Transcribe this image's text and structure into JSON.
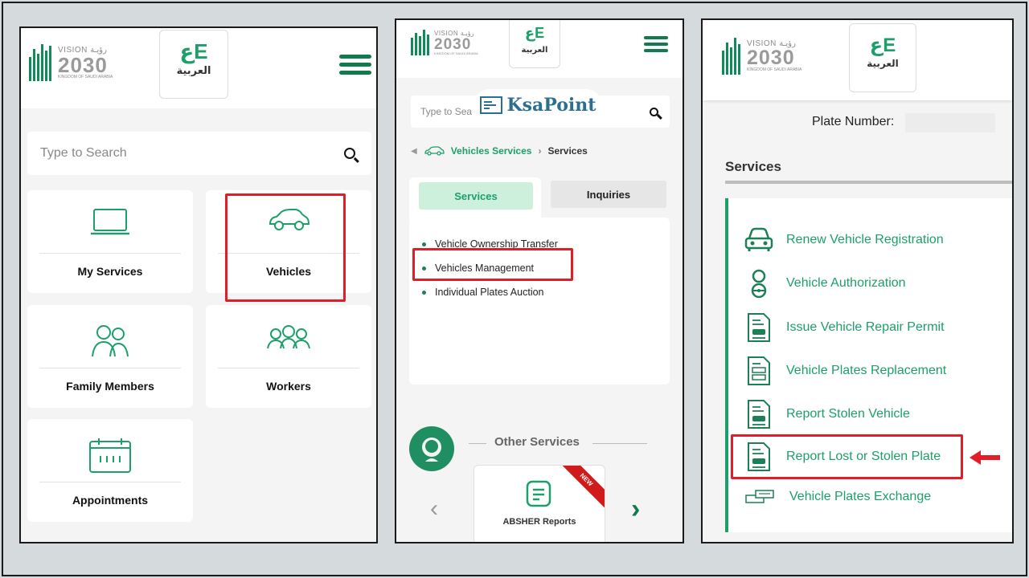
{
  "colors": {
    "brand_green": "#1d9f6a",
    "highlight_red": "#e31d25"
  },
  "header": {
    "vision_label": "VISION رؤيـة",
    "vision_year": "2030",
    "vision_sub": "KINGDOM OF SAUDI ARABIA",
    "lang_label": "العربية",
    "lang_glyph": "عE"
  },
  "panel1": {
    "search_placeholder": "Type to Search",
    "tiles": [
      {
        "label": "My Services",
        "icon": "laptop-icon"
      },
      {
        "label": "Vehicles",
        "icon": "car-icon"
      },
      {
        "label": "Family Members",
        "icon": "family-icon"
      },
      {
        "label": "Workers",
        "icon": "workers-icon"
      },
      {
        "label": "Appointments",
        "icon": "calendar-icon"
      }
    ]
  },
  "panel2": {
    "search_placeholder": "Type to Sea",
    "watermark": "KsaPoint",
    "breadcrumb": {
      "parent": "Vehicles Services",
      "current": "Services"
    },
    "tabs": [
      "Services",
      "Inquiries"
    ],
    "services": [
      "Vehicle Ownership Transfer",
      "Vehicles Management",
      "Individual Plates Auction"
    ],
    "other_services_title": "Other Services",
    "report_card": {
      "label": "ABSHER Reports",
      "badge": "NEW"
    }
  },
  "panel3": {
    "plate_label": "Plate Number:",
    "services_heading": "Services",
    "items": [
      {
        "label": "Renew Vehicle Registration",
        "icon": "car-front-icon"
      },
      {
        "label": "Vehicle Authorization",
        "icon": "driver-icon"
      },
      {
        "label": "Issue Vehicle Repair Permit",
        "icon": "document-icon"
      },
      {
        "label": "Vehicle Plates Replacement",
        "icon": "document-icon"
      },
      {
        "label": "Report Stolen Vehicle",
        "icon": "document-icon"
      },
      {
        "label": "Report Lost or Stolen Plate",
        "icon": "document-icon"
      },
      {
        "label": "Vehicle Plates Exchange",
        "icon": "plates-icon"
      }
    ]
  }
}
